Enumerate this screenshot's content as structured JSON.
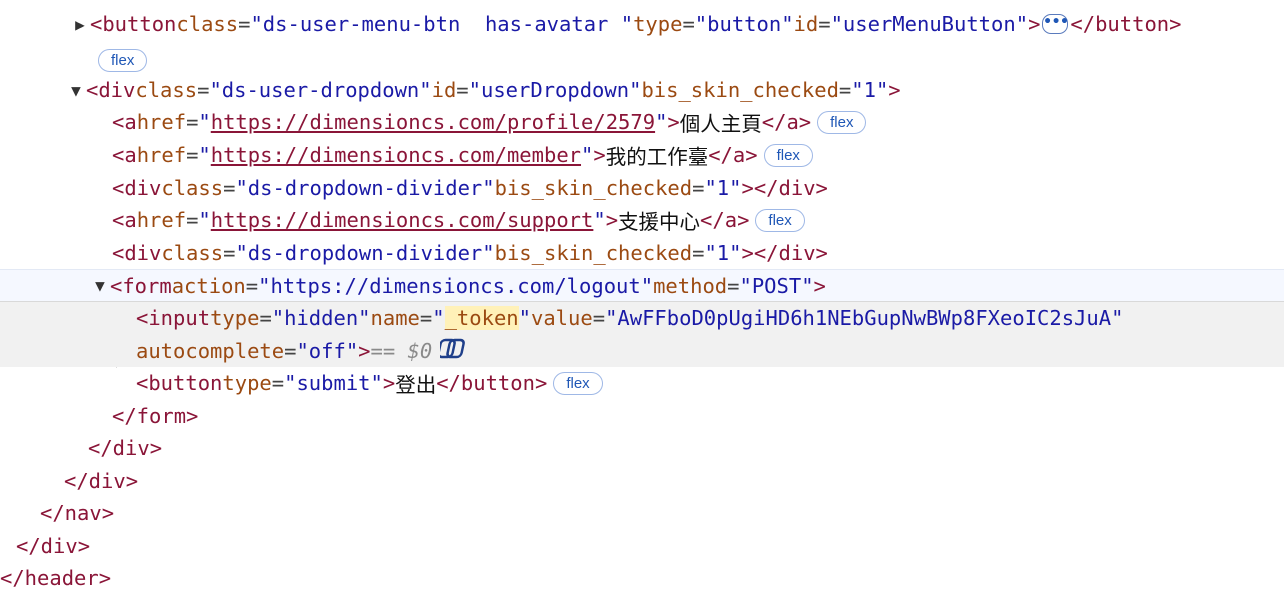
{
  "badge": "flex",
  "eq_dollar0": "== $0",
  "lines": {
    "l0_tag_open": "<button",
    "l0_class_attr": "class",
    "l0_class_val": "\"ds-user-menu-btn  has-avatar \"",
    "l0_type_attr": "type",
    "l0_type_val": "\"button\"",
    "l0_id_attr": "id",
    "l0_id_val": "\"userMenuButton\"",
    "l0_close": "</button>",
    "l2_tag": "<div",
    "l2_class_attr": "class",
    "l2_class_val": "\"ds-user-dropdown\"",
    "l2_id_attr": "id",
    "l2_id_val": "\"userDropdown\"",
    "l2_bis_attr": "bis_skin_checked",
    "l2_bis_val": "\"1\"",
    "a_tag": "<a",
    "href_attr": "href",
    "a1_href": "https://dimensioncs.com/profile/2579",
    "a1_text": "個人主頁",
    "a2_href": "https://dimensioncs.com/member",
    "a2_text": "我的工作臺",
    "a3_href": "https://dimensioncs.com/support",
    "a3_text": "支援中心",
    "a_close": "</a>",
    "div_tag": "<div",
    "divider_class_attr": "class",
    "divider_class_val": "\"ds-dropdown-divider\"",
    "divider_bis_attr": "bis_skin_checked",
    "divider_bis_val": "\"1\"",
    "div_close": "</div>",
    "form_tag": "<form",
    "form_action_attr": "action",
    "form_action_val": "\"https://dimensioncs.com/logout\"",
    "form_method_attr": "method",
    "form_method_val": "\"POST\"",
    "input_tag": "<input",
    "input_type_attr": "type",
    "input_type_val": "\"hidden\"",
    "input_name_attr": "name",
    "input_name_q1": "\"",
    "input_name_val": "_token",
    "input_name_q2": "\"",
    "input_value_attr": "value",
    "input_value_val": "\"AwFFboD0pUgiHD6h1NEbGupNwBWp8FXeoIC2sJuA\"",
    "input_autocomplete_attr": "autocomplete",
    "input_autocomplete_val": "\"off\"",
    "button_tag": "<button",
    "button_type_attr": "type",
    "button_type_val": "\"submit\"",
    "button_text": "登出",
    "button_close": "</button>",
    "form_close": "</form>",
    "close_div": "</div>",
    "close_nav": "</nav>",
    "close_header": "</header>"
  }
}
